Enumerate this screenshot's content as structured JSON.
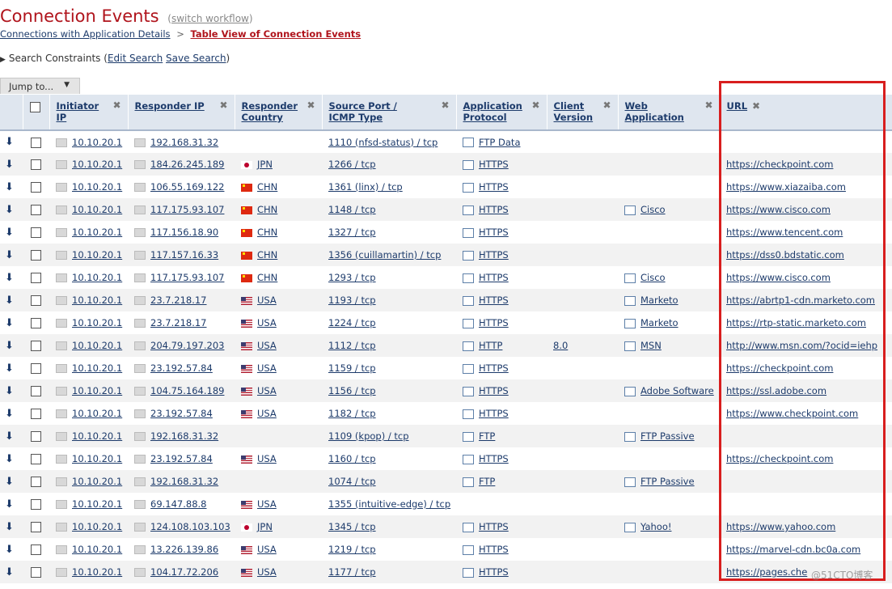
{
  "header": {
    "title": "Connection Events",
    "switch_prefix": "(",
    "switch_label": "switch workflow",
    "switch_suffix": ")"
  },
  "breadcrumb": {
    "parent": "Connections with Application Details",
    "separator": ">",
    "current": "Table View of Connection Events"
  },
  "constraints": {
    "label": "Search Constraints (",
    "edit_label": "Edit Search",
    "save_label": "Save Search",
    "suffix": ")"
  },
  "jump": {
    "label": "Jump to...",
    "caret": "▼"
  },
  "columns": {
    "initiator_ip": "Initiator IP",
    "responder_ip": "Responder IP",
    "responder_country": "Responder Country",
    "source_port": "Source Port / ICMP Type",
    "application_protocol": "Application Protocol",
    "client_version": "Client Version",
    "web_application": "Web Application",
    "url": "URL",
    "remove_glyph": "✖"
  },
  "row_arrow": "⬇",
  "rows": [
    {
      "initiator": "10.10.20.1",
      "responder": "192.168.31.32",
      "country": "",
      "port": "1110 (nfsd-status) / tcp",
      "protocol": "FTP Data",
      "client_version": "",
      "web_app": "",
      "url": ""
    },
    {
      "initiator": "10.10.20.1",
      "responder": "184.26.245.189",
      "country": "JPN",
      "port": "1266 / tcp",
      "protocol": "HTTPS",
      "client_version": "",
      "web_app": "",
      "url": "https://checkpoint.com"
    },
    {
      "initiator": "10.10.20.1",
      "responder": "106.55.169.122",
      "country": "CHN",
      "port": "1361 (linx) / tcp",
      "protocol": "HTTPS",
      "client_version": "",
      "web_app": "",
      "url": "https://www.xiazaiba.com"
    },
    {
      "initiator": "10.10.20.1",
      "responder": "117.175.93.107",
      "country": "CHN",
      "port": "1148 / tcp",
      "protocol": "HTTPS",
      "client_version": "",
      "web_app": "Cisco",
      "url": "https://www.cisco.com"
    },
    {
      "initiator": "10.10.20.1",
      "responder": "117.156.18.90",
      "country": "CHN",
      "port": "1327 / tcp",
      "protocol": "HTTPS",
      "client_version": "",
      "web_app": "",
      "url": "https://www.tencent.com"
    },
    {
      "initiator": "10.10.20.1",
      "responder": "117.157.16.33",
      "country": "CHN",
      "port": "1356 (cuillamartin) / tcp",
      "protocol": "HTTPS",
      "client_version": "",
      "web_app": "",
      "url": "https://dss0.bdstatic.com"
    },
    {
      "initiator": "10.10.20.1",
      "responder": "117.175.93.107",
      "country": "CHN",
      "port": "1293 / tcp",
      "protocol": "HTTPS",
      "client_version": "",
      "web_app": "Cisco",
      "url": "https://www.cisco.com"
    },
    {
      "initiator": "10.10.20.1",
      "responder": "23.7.218.17",
      "country": "USA",
      "port": "1193 / tcp",
      "protocol": "HTTPS",
      "client_version": "",
      "web_app": "Marketo",
      "url": "https://abrtp1-cdn.marketo.com"
    },
    {
      "initiator": "10.10.20.1",
      "responder": "23.7.218.17",
      "country": "USA",
      "port": "1224 / tcp",
      "protocol": "HTTPS",
      "client_version": "",
      "web_app": "Marketo",
      "url": "https://rtp-static.marketo.com"
    },
    {
      "initiator": "10.10.20.1",
      "responder": "204.79.197.203",
      "country": "USA",
      "port": "1112 / tcp",
      "protocol": "HTTP",
      "client_version": "8.0",
      "web_app": "MSN",
      "url": "http://www.msn.com/?ocid=iehp"
    },
    {
      "initiator": "10.10.20.1",
      "responder": "23.192.57.84",
      "country": "USA",
      "port": "1159 / tcp",
      "protocol": "HTTPS",
      "client_version": "",
      "web_app": "",
      "url": "https://checkpoint.com"
    },
    {
      "initiator": "10.10.20.1",
      "responder": "104.75.164.189",
      "country": "USA",
      "port": "1156 / tcp",
      "protocol": "HTTPS",
      "client_version": "",
      "web_app": "Adobe Software",
      "url": "https://ssl.adobe.com"
    },
    {
      "initiator": "10.10.20.1",
      "responder": "23.192.57.84",
      "country": "USA",
      "port": "1182 / tcp",
      "protocol": "HTTPS",
      "client_version": "",
      "web_app": "",
      "url": "https://www.checkpoint.com"
    },
    {
      "initiator": "10.10.20.1",
      "responder": "192.168.31.32",
      "country": "",
      "port": "1109 (kpop) / tcp",
      "protocol": "FTP",
      "client_version": "",
      "web_app": "FTP Passive",
      "url": ""
    },
    {
      "initiator": "10.10.20.1",
      "responder": "23.192.57.84",
      "country": "USA",
      "port": "1160 / tcp",
      "protocol": "HTTPS",
      "client_version": "",
      "web_app": "",
      "url": "https://checkpoint.com"
    },
    {
      "initiator": "10.10.20.1",
      "responder": "192.168.31.32",
      "country": "",
      "port": "1074 / tcp",
      "protocol": "FTP",
      "client_version": "",
      "web_app": "FTP Passive",
      "url": ""
    },
    {
      "initiator": "10.10.20.1",
      "responder": "69.147.88.8",
      "country": "USA",
      "port": "1355 (intuitive-edge) / tcp",
      "protocol": "",
      "client_version": "",
      "web_app": "",
      "url": ""
    },
    {
      "initiator": "10.10.20.1",
      "responder": "124.108.103.103",
      "country": "JPN",
      "port": "1345 / tcp",
      "protocol": "HTTPS",
      "client_version": "",
      "web_app": "Yahoo!",
      "url": "https://www.yahoo.com"
    },
    {
      "initiator": "10.10.20.1",
      "responder": "13.226.139.86",
      "country": "USA",
      "port": "1219 / tcp",
      "protocol": "HTTPS",
      "client_version": "",
      "web_app": "",
      "url": "https://marvel-cdn.bc0a.com"
    },
    {
      "initiator": "10.10.20.1",
      "responder": "104.17.72.206",
      "country": "USA",
      "port": "1177 / tcp",
      "protocol": "HTTPS",
      "client_version": "",
      "web_app": "",
      "url": "https://pages.che"
    }
  ],
  "watermark": "@51CTO博客",
  "colors": {
    "title": "#b0141c",
    "link": "#1d3b6b",
    "header_bg": "#dfe6ef",
    "highlight_box": "#d81e1e"
  }
}
